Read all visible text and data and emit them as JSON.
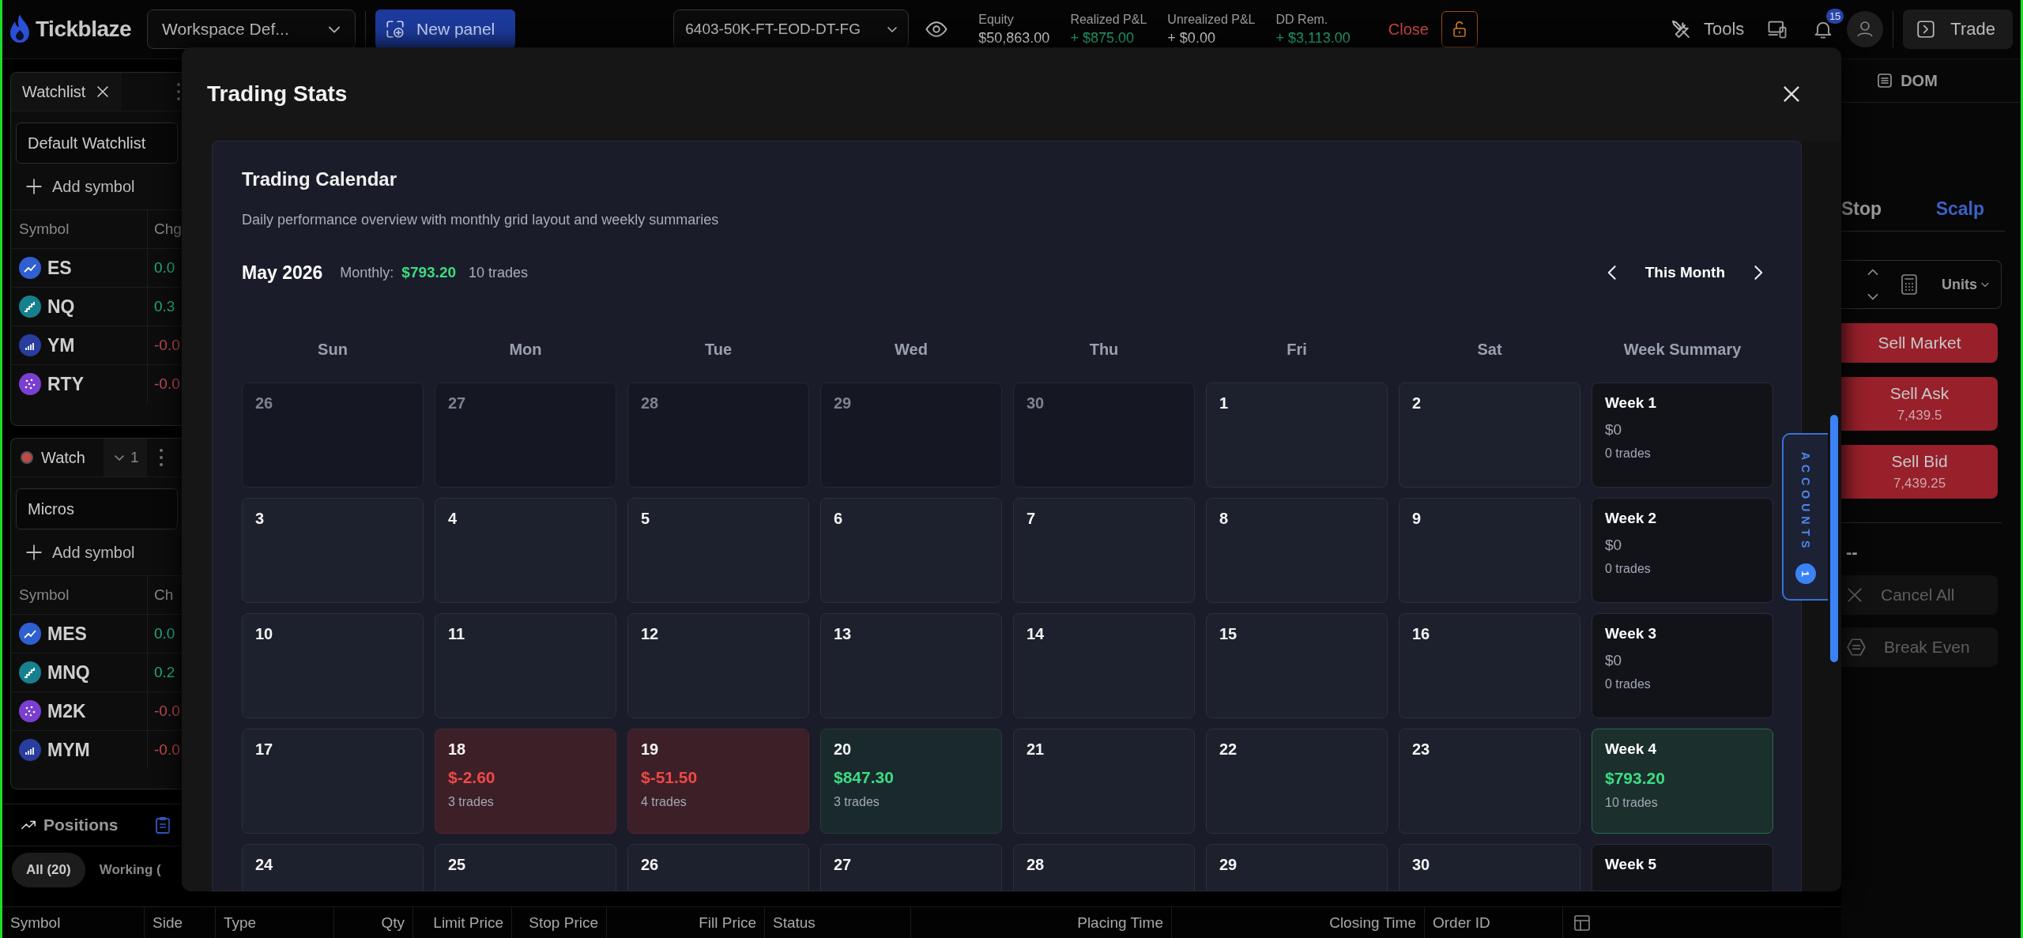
{
  "topbar": {
    "brand": "Tickblaze",
    "workspace": "Workspace Def...",
    "new_panel": "New panel",
    "account": "6403-50K-FT-EOD-DT-FG",
    "stats": [
      {
        "label": "Equity",
        "value": "$50,863.00",
        "positive": false
      },
      {
        "label": "Realized P&L",
        "value": "+ $875.00",
        "positive": true
      },
      {
        "label": "Unrealized P&L",
        "value": "+ $0.00",
        "positive": false
      },
      {
        "label": "DD Rem.",
        "value": "+ $3,113.00",
        "positive": true
      }
    ],
    "close": "Close",
    "tools": "Tools",
    "notifications": "15",
    "trade": "Trade"
  },
  "watchlists": [
    {
      "kind": "tab",
      "title": "Watchlist",
      "list": "Default Watchlist",
      "add": "Add symbol",
      "columns": [
        "Symbol",
        "Chg"
      ],
      "rows": [
        {
          "symbol": "ES",
          "change": "0.0",
          "negative": false,
          "kind": "trend",
          "color": "#2f5fd0"
        },
        {
          "symbol": "NQ",
          "change": "0.3",
          "negative": false,
          "kind": "steps",
          "color": "#16808f"
        },
        {
          "symbol": "YM",
          "change": "-0.0",
          "negative": true,
          "kind": "bars",
          "color": "#283d9e"
        },
        {
          "symbol": "RTY",
          "change": "-0.0",
          "negative": true,
          "kind": "dots",
          "color": "#7a3fd0"
        }
      ]
    },
    {
      "kind": "group",
      "title": "Watch",
      "badge": "1",
      "list": "Micros",
      "add": "Add symbol",
      "columns": [
        "Symbol",
        "Ch"
      ],
      "rows": [
        {
          "symbol": "MES",
          "change": "0.0",
          "negative": false,
          "kind": "trend",
          "color": "#2f5fd0"
        },
        {
          "symbol": "MNQ",
          "change": "0.2",
          "negative": false,
          "kind": "steps",
          "color": "#16808f"
        },
        {
          "symbol": "M2K",
          "change": "-0.0",
          "negative": true,
          "kind": "dots",
          "color": "#7a3fd0"
        },
        {
          "symbol": "MYM",
          "change": "-0.0",
          "negative": true,
          "kind": "bars",
          "color": "#283d9e"
        }
      ]
    }
  ],
  "positions": {
    "title": "Positions",
    "filters": [
      {
        "label": "All (20)",
        "selected": true
      },
      {
        "label": "Working (",
        "selected": false
      }
    ],
    "columns": [
      "Symbol",
      "Side",
      "Type",
      "Qty",
      "Limit Price",
      "Stop Price",
      "Fill Price",
      "Status",
      "Placing Time",
      "Closing Time",
      "Order ID"
    ]
  },
  "order_panel": {
    "tab": "DOM",
    "order_types": [
      {
        "label": "Stop",
        "selected": false
      },
      {
        "label": "Scalp",
        "selected": true
      }
    ],
    "units": "Units",
    "sell_buttons": [
      {
        "label": "Sell Market"
      },
      {
        "label": "Sell Ask",
        "price": "7,439.5"
      },
      {
        "label": "Sell Bid",
        "price": "7,439.25"
      }
    ],
    "position": "--",
    "actions": [
      {
        "label": "Cancel All",
        "kind": "cancel"
      },
      {
        "label": "Break Even",
        "kind": "breakeven"
      }
    ]
  },
  "modal": {
    "title": "Trading Stats",
    "calendar": {
      "title": "Trading Calendar",
      "subtitle": "Daily performance overview with monthly grid layout and weekly summaries",
      "month": "May 2026",
      "monthly_label": "Monthly:",
      "monthly_value": "$793.20",
      "monthly_trades": "10 trades",
      "period": "This Month",
      "weekdays": [
        "Sun",
        "Mon",
        "Tue",
        "Wed",
        "Thu",
        "Fri",
        "Sat"
      ],
      "summary_heading": "Week Summary",
      "weeks": [
        {
          "days": [
            {
              "day": "26",
              "in_month": false
            },
            {
              "day": "27",
              "in_month": false
            },
            {
              "day": "28",
              "in_month": false
            },
            {
              "day": "29",
              "in_month": false
            },
            {
              "day": "30",
              "in_month": false
            },
            {
              "day": "1",
              "in_month": true
            },
            {
              "day": "2",
              "in_month": true
            }
          ],
          "summary": {
            "label": "Week 1",
            "pnl": "$0",
            "trades": "0 trades",
            "profit": false
          }
        },
        {
          "days": [
            {
              "day": "3",
              "in_month": true
            },
            {
              "day": "4",
              "in_month": true
            },
            {
              "day": "5",
              "in_month": true
            },
            {
              "day": "6",
              "in_month": true
            },
            {
              "day": "7",
              "in_month": true
            },
            {
              "day": "8",
              "in_month": true
            },
            {
              "day": "9",
              "in_month": true
            }
          ],
          "summary": {
            "label": "Week 2",
            "pnl": "$0",
            "trades": "0 trades",
            "profit": false
          }
        },
        {
          "days": [
            {
              "day": "10",
              "in_month": true
            },
            {
              "day": "11",
              "in_month": true
            },
            {
              "day": "12",
              "in_month": true
            },
            {
              "day": "13",
              "in_month": true
            },
            {
              "day": "14",
              "in_month": true
            },
            {
              "day": "15",
              "in_month": true
            },
            {
              "day": "16",
              "in_month": true
            }
          ],
          "summary": {
            "label": "Week 3",
            "pnl": "$0",
            "trades": "0 trades",
            "profit": false
          }
        },
        {
          "days": [
            {
              "day": "17",
              "in_month": true
            },
            {
              "day": "18",
              "in_month": true,
              "pnl": "$-2.60",
              "trades": "3 trades",
              "profit": false
            },
            {
              "day": "19",
              "in_month": true,
              "pnl": "$-51.50",
              "trades": "4 trades",
              "profit": false
            },
            {
              "day": "20",
              "in_month": true,
              "pnl": "$847.30",
              "trades": "3 trades",
              "profit": true
            },
            {
              "day": "21",
              "in_month": true
            },
            {
              "day": "22",
              "in_month": true
            },
            {
              "day": "23",
              "in_month": true
            }
          ],
          "summary": {
            "label": "Week 4",
            "pnl": "$793.20",
            "trades": "10 trades",
            "profit": true
          }
        },
        {
          "days": [
            {
              "day": "24",
              "in_month": true
            },
            {
              "day": "25",
              "in_month": true
            },
            {
              "day": "26",
              "in_month": true
            },
            {
              "day": "27",
              "in_month": true
            },
            {
              "day": "28",
              "in_month": true
            },
            {
              "day": "29",
              "in_month": true
            },
            {
              "day": "30",
              "in_month": true
            }
          ],
          "summary": {
            "label": "Week 5",
            "profit": false
          }
        }
      ]
    }
  },
  "accounts_tab": {
    "label": "ACCOUNTS",
    "count": "1"
  }
}
